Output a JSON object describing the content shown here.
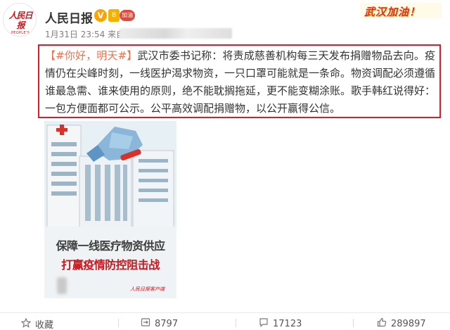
{
  "account": {
    "name": "人民日报",
    "avatar_logo": "人民日报",
    "avatar_sub": "PEOPLE'S DAILY",
    "verified_icon": "v-verified-icon",
    "verified_label": "V",
    "level_label": "8",
    "heart_label": "加油"
  },
  "post": {
    "date": "1月31日 23:54 来自",
    "hashtag": "【#你好，明天#】",
    "text": "武汉市委书记称：将责成慈善机构每三天发布捐赠物品去向。疫情仍在尖峰时刻，一线医护渴求物资，一只口罩可能就是一条命。物资调配必须遵循谁最急需、谁来使用的原则，绝不能耽搁拖延，更不能变糊涂账。歌手韩红说得好：一包方便面都可公示。公平高效调配捐赠物，以公开赢得公信。"
  },
  "promo": {
    "text": "武汉加油！",
    "accent": "#e02e24"
  },
  "poster": {
    "title_line1": "保障一线医疗物资供应",
    "title_line2": "打赢疫情防控阻击战",
    "footer": "人民日报客户端"
  },
  "actions": {
    "favorite_label": "收藏",
    "repost_count": "8797",
    "comment_count": "17123",
    "like_count": "289897"
  },
  "colors": {
    "highlight_border": "#d61f2d",
    "hashtag": "#eb7350",
    "brand_red": "#c8161d"
  }
}
